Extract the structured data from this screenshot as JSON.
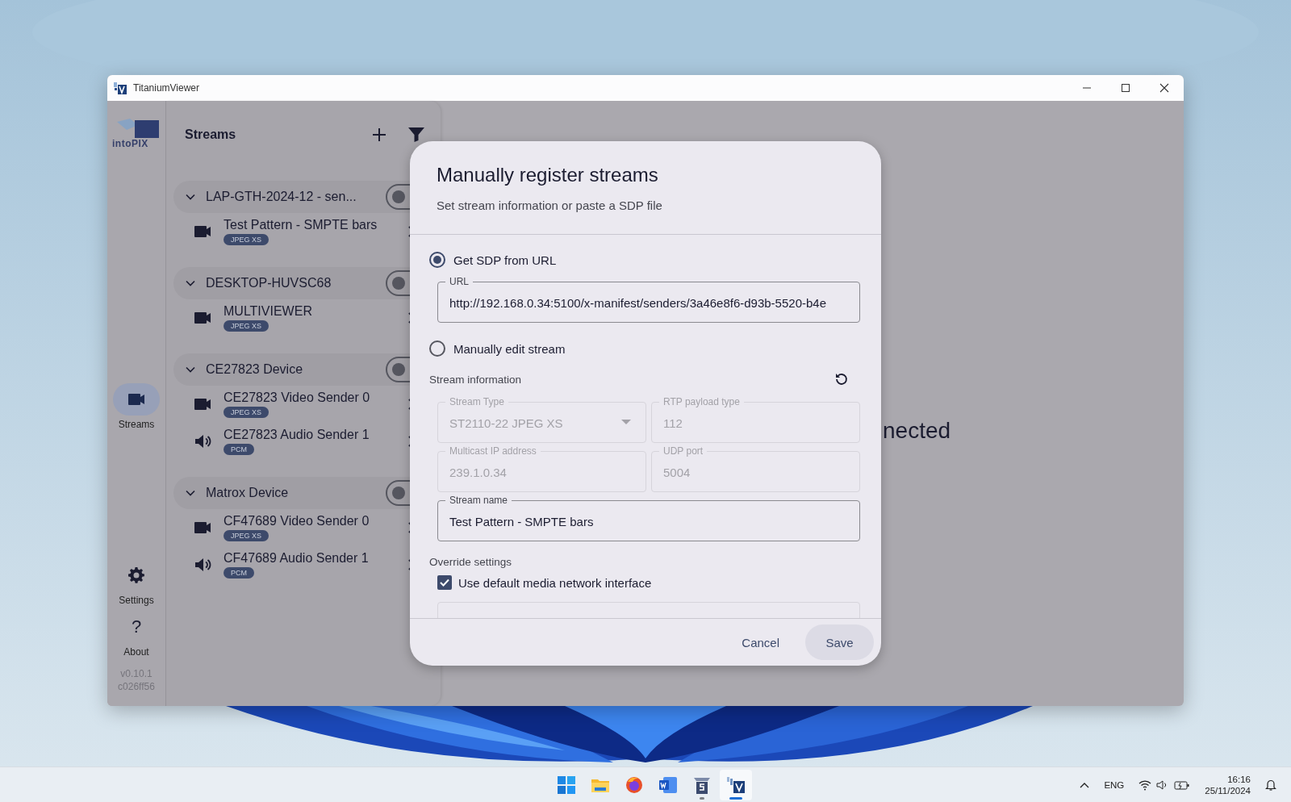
{
  "window": {
    "title": "TitaniumViewer"
  },
  "rail": {
    "logo": "intoPIX",
    "items": [
      {
        "kind": "streams",
        "label": "Streams",
        "selected": true
      }
    ],
    "footer_items": [
      {
        "kind": "settings",
        "label": "Settings",
        "selected": false
      },
      {
        "kind": "about",
        "glyph": "?",
        "label": "About",
        "selected": false
      }
    ],
    "version": "v0.10.1",
    "commit": "c026ff56"
  },
  "streams_panel": {
    "title": "Streams",
    "groups": [
      {
        "name": "LAP-GTH-2024-12 - sen...",
        "expanded": true,
        "on": false,
        "streams": [
          {
            "kind": "video",
            "name": "Test Pattern - SMPTE bars",
            "format": "JPEG XS"
          }
        ]
      },
      {
        "name": "DESKTOP-HUVSC68",
        "expanded": true,
        "on": false,
        "streams": [
          {
            "kind": "video",
            "name": "MULTIVIEWER",
            "format": "JPEG XS"
          }
        ]
      },
      {
        "name": "CE27823 Device",
        "expanded": true,
        "on": false,
        "streams": [
          {
            "kind": "video",
            "name": "CE27823 Video Sender 0",
            "format": "JPEG XS"
          },
          {
            "kind": "audio",
            "name": "CE27823 Audio Sender 1",
            "format": "PCM"
          }
        ]
      },
      {
        "name": "Matrox Device",
        "expanded": true,
        "on": false,
        "streams": [
          {
            "kind": "video",
            "name": "CF47689 Video Sender 0",
            "format": "JPEG XS"
          },
          {
            "kind": "audio",
            "name": "CF47689 Audio Sender 1",
            "format": "PCM"
          }
        ]
      }
    ]
  },
  "main": {
    "status_text": "nected"
  },
  "dialog": {
    "title": "Manually register streams",
    "subtitle": "Set stream information or paste a SDP file",
    "source_options": [
      {
        "label": "Get SDP from URL",
        "selected": true
      },
      {
        "label": "Manually edit stream",
        "selected": false
      }
    ],
    "url_field": {
      "label": "URL",
      "value": "http://192.168.0.34:5100/x-manifest/senders/3a46e8f6-d93b-5520-b4e"
    },
    "section_title": "Stream information",
    "fields": [
      {
        "kind": "select",
        "label": "Stream Type",
        "value": "ST2110-22 JPEG XS",
        "disabled": true
      },
      {
        "kind": "text",
        "label": "RTP payload type",
        "value": "112",
        "disabled": true
      },
      {
        "kind": "text",
        "label": "Multicast IP address",
        "value": "239.1.0.34",
        "disabled": true
      },
      {
        "kind": "text",
        "label": "UDP port",
        "value": "5004",
        "disabled": true
      }
    ],
    "name_field": {
      "label": "Stream name",
      "value": "Test Pattern - SMPTE bars",
      "disabled": false
    },
    "override_title": "Override settings",
    "checkbox": {
      "label": "Use default media network interface",
      "checked": true
    },
    "buttons": [
      {
        "kind": "text",
        "label": "Cancel"
      },
      {
        "kind": "tonal",
        "label": "Save"
      }
    ]
  },
  "taskbar": {
    "apps": [
      {
        "kind": "start",
        "running": false,
        "active": false
      },
      {
        "kind": "folder",
        "running": false,
        "active": false
      },
      {
        "kind": "browser",
        "running": false,
        "active": false
      },
      {
        "kind": "word",
        "running": false,
        "active": false
      },
      {
        "kind": "s-app",
        "running": true,
        "active": false
      },
      {
        "kind": "viewer",
        "running": true,
        "active": true
      }
    ],
    "language": "ENG",
    "time": "16:16",
    "date": "25/11/2024"
  }
}
